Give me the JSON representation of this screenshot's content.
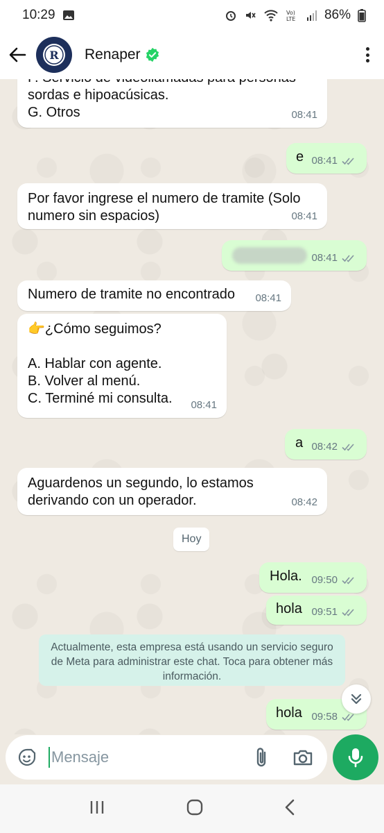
{
  "status_bar": {
    "time": "10:29",
    "battery": "86%",
    "icons": [
      "image-icon",
      "alarm-icon",
      "mute-icon",
      "wifi-icon",
      "volte-icon",
      "signal-icon",
      "battery-icon"
    ]
  },
  "header": {
    "contact_name": "Renaper",
    "verified": true,
    "accent_color": "#1daa61"
  },
  "messages": [
    {
      "dir": "in",
      "text": "F. Servicio de videollamadas para personas\nsordas e hipoacúsicas.\nG. Otros",
      "time": "08:41"
    },
    {
      "dir": "out",
      "text": "e",
      "time": "08:41"
    },
    {
      "dir": "in",
      "text": "Por favor ingrese el numero de tramite (Solo\nnumero sin espacios)",
      "time": "08:41"
    },
    {
      "dir": "out",
      "text": "",
      "time": "08:41"
    },
    {
      "dir": "in",
      "text": "Numero de tramite no encontrado",
      "time": "08:41"
    },
    {
      "dir": "in",
      "text": "👉¿Cómo seguimos?\n\nA. Hablar con agente.\nB. Volver al menú.\nC. Terminé mi consulta.",
      "time": "08:41"
    },
    {
      "dir": "out",
      "text": "a",
      "time": "08:42"
    },
    {
      "dir": "in",
      "text": "Aguardenos un segundo, lo estamos\nderivando con un operador.",
      "time": "08:42"
    },
    {
      "dir": "out",
      "text": "Hola.",
      "time": "09:50"
    },
    {
      "dir": "out",
      "text": "hola",
      "time": "09:51"
    },
    {
      "dir": "out",
      "text": "hola",
      "time": "09:58"
    }
  ],
  "day_divider": "Hoy",
  "notice": "Actualmente, esta empresa está usando un servicio seguro de Meta para administrar este chat. Toca para obtener más información.",
  "composer": {
    "placeholder": "Mensaje"
  }
}
